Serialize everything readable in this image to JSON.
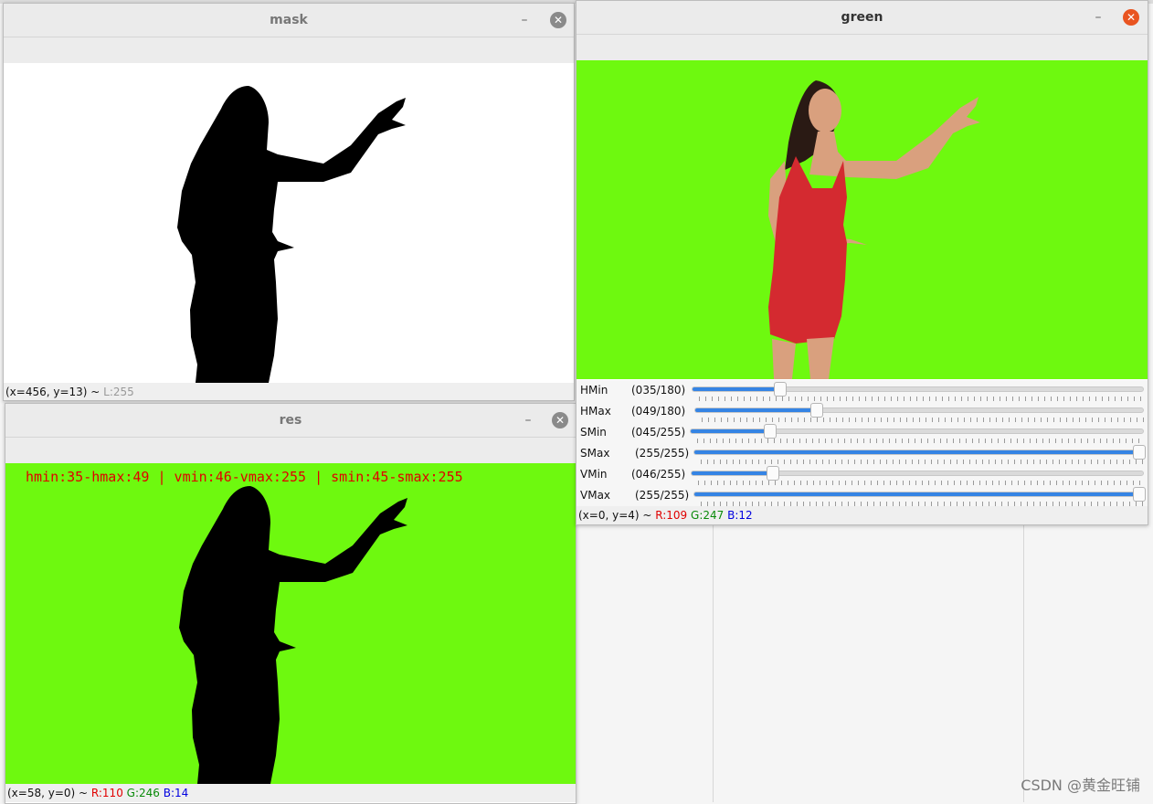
{
  "mask_window": {
    "title": "mask",
    "status": {
      "coords": "(x=456, y=13) ~ ",
      "l_text": "L:255"
    }
  },
  "res_window": {
    "title": "res",
    "overlay_text": "hmin:35-hmax:49 | vmin:46-vmax:255 | smin:45-smax:255",
    "status": {
      "coords": "(x=58, y=0) ~ ",
      "r_text": "R:110",
      "g_text": "G:246",
      "b_text": "B:14"
    }
  },
  "green_window": {
    "title": "green",
    "trackbars": [
      {
        "name": "HMin",
        "value_text": "(035/180)",
        "value": 35,
        "max": 180
      },
      {
        "name": "HMax",
        "value_text": "(049/180)",
        "value": 49,
        "max": 180
      },
      {
        "name": "SMin",
        "value_text": "(045/255)",
        "value": 45,
        "max": 255
      },
      {
        "name": "SMax",
        "value_text": "(255/255)",
        "value": 255,
        "max": 255
      },
      {
        "name": "VMin",
        "value_text": "(046/255)",
        "value": 46,
        "max": 255
      },
      {
        "name": "VMax",
        "value_text": "(255/255)",
        "value": 255,
        "max": 255
      }
    ],
    "status": {
      "coords": "(x=0, y=4) ~ ",
      "r_text": "R:109",
      "g_text": "G:247",
      "b_text": "B:12"
    }
  },
  "watermark": "CSDN @黄金旺铺",
  "colors": {
    "green_screen": "#6ef90f",
    "dress": "#d42a30",
    "silhouette": "#000000",
    "overlay_text": "#e00000",
    "slider_fill": "#3584e4",
    "active_close": "#e95420"
  },
  "icons": {
    "minimize": "minimize-icon",
    "close": "close-icon"
  }
}
